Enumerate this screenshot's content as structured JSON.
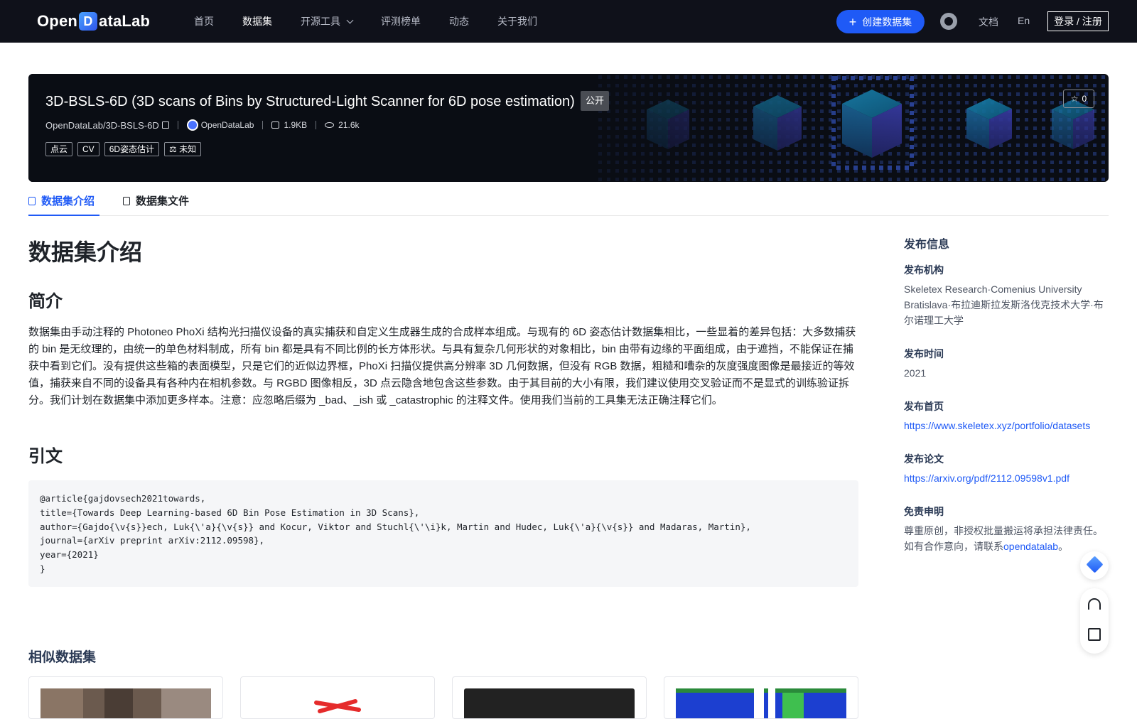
{
  "nav": {
    "logo_prefix": "Open",
    "logo_mark": "D",
    "logo_suffix": "ataLab",
    "items": [
      {
        "label": "首页"
      },
      {
        "label": "数据集",
        "active": true
      },
      {
        "label": "开源工具"
      },
      {
        "label": "评测榜单"
      },
      {
        "label": "动态"
      },
      {
        "label": "关于我们"
      }
    ],
    "create_label": "创建数据集",
    "docs_label": "文档",
    "lang_label": "En",
    "login_label": "登录 / 注册",
    "icons": [
      "plus-icon",
      "github-icon",
      "chevron-down-icon"
    ]
  },
  "dataset": {
    "title": "3D-BSLS-6D (3D scans of Bins by Structured-Light Scanner for 6D pose estimation)",
    "visibility": "公开",
    "path": "OpenDataLab/3D-BSLS-6D",
    "org": "OpenDataLab",
    "size": "1.9KB",
    "views": "21.6k",
    "tags": [
      "点云",
      "CV",
      "6D姿态估计",
      "⚖ 未知"
    ],
    "stars": "0"
  },
  "tabs": {
    "intro": "数据集介绍",
    "files": "数据集文件"
  },
  "content": {
    "h1": "数据集介绍",
    "summary_heading": "简介",
    "summary": "数据集由手动注释的 Photoneo PhoXi 结构光扫描仪设备的真实捕获和自定义生成器生成的合成样本组成。与现有的 6D 姿态估计数据集相比，一些显着的差异包括：大多数捕获的 bin 是无纹理的，由统一的单色材料制成，所有 bin 都是具有不同比例的长方体形状。与具有复杂几何形状的对象相比，bin 由带有边缘的平面组成，由于遮挡，不能保证在捕获中看到它们。没有提供这些箱的表面模型，只是它们的近似边界框，PhoXi 扫描仪提供高分辨率 3D 几何数据，但没有 RGB 数据，粗糙和嘈杂的灰度强度图像是最接近的等效值，捕获来自不同的设备具有各种内在相机参数。与 RGBD 图像相反，3D 点云隐含地包含这些参数。由于其目前的大小有限，我们建议使用交叉验证而不是显式的训练验证拆分。我们计划在数据集中添加更多样本。注意：应忽略后缀为 _bad、_ish 或 _catastrophic 的注释文件。使用我们当前的工具集无法正确注释它们。",
    "citation_heading": "引文",
    "citation": "@article{gajdovsech2021towards,\ntitle={Towards Deep Learning-based 6D Bin Pose Estimation in 3D Scans},\nauthor={Gajdo{\\v{s}}ech, Luk{\\'a}{\\v{s}} and Kocur, Viktor and Stuchl{\\'\\i}k, Martin and Hudec, Luk{\\'a}{\\v{s}} and Madaras, Martin},\njournal={arXiv preprint arXiv:2112.09598},\nyear={2021}\n}",
    "similar_heading": "相似数据集"
  },
  "sidebar": {
    "title": "发布信息",
    "org_label": "发布机构",
    "org_value": "Skeletex Research·Comenius University Bratislava·布拉迪斯拉发斯洛伐克技术大学·布尔诺理工大学",
    "time_label": "发布时间",
    "time_value": "2021",
    "home_label": "发布首页",
    "home_value": "https://www.skeletex.xyz/portfolio/datasets",
    "paper_label": "发布论文",
    "paper_value": "https://arxiv.org/pdf/2112.09598v1.pdf",
    "disclaimer_label": "免责申明",
    "disclaimer_text": "尊重原创，非授权批量搬运将承担法律责任。如有合作意向，请联系",
    "disclaimer_link": "opendatalab",
    "disclaimer_end": "。"
  },
  "colors": {
    "nav_bg": "#0f111a",
    "accent": "#1f5af6",
    "banner_bg": "#0a0d14"
  }
}
